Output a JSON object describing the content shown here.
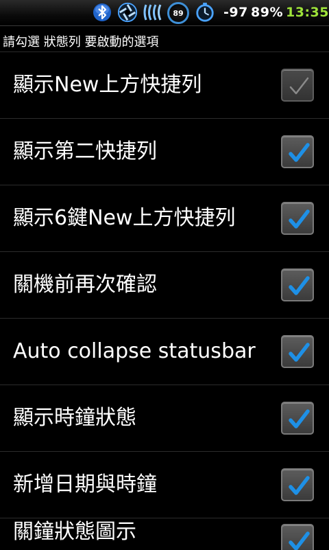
{
  "status_bar": {
    "battery_level": "89",
    "signal": "-97",
    "battery_percent": "89%",
    "time": "13:35",
    "time_color": "#9ee33a",
    "icons": [
      "bluetooth-icon",
      "aperture-icon",
      "wifi-signal-icon",
      "battery-circle-icon",
      "stopwatch-icon"
    ]
  },
  "header": {
    "title": "請勾選 狀態列 要啟動的選項"
  },
  "items": [
    {
      "label": "顯示New上方快捷列",
      "checked": true,
      "enabled": false
    },
    {
      "label": "顯示第二快捷列",
      "checked": true,
      "enabled": true
    },
    {
      "label": "顯示6鍵New上方快捷列",
      "checked": true,
      "enabled": true
    },
    {
      "label": "關機前再次確認",
      "checked": true,
      "enabled": true
    },
    {
      "label": "Auto collapse statusbar",
      "checked": true,
      "enabled": true
    },
    {
      "label": "顯示時鐘狀態",
      "checked": true,
      "enabled": true
    },
    {
      "label": "新增日期與時鐘",
      "checked": true,
      "enabled": true
    },
    {
      "label": "關鐘狀態圖示",
      "checked": true,
      "enabled": true
    }
  ],
  "colors": {
    "check_enabled": "#1e90e6",
    "check_disabled": "#8a8a8a",
    "accent_blue": "#3e8fd6"
  }
}
